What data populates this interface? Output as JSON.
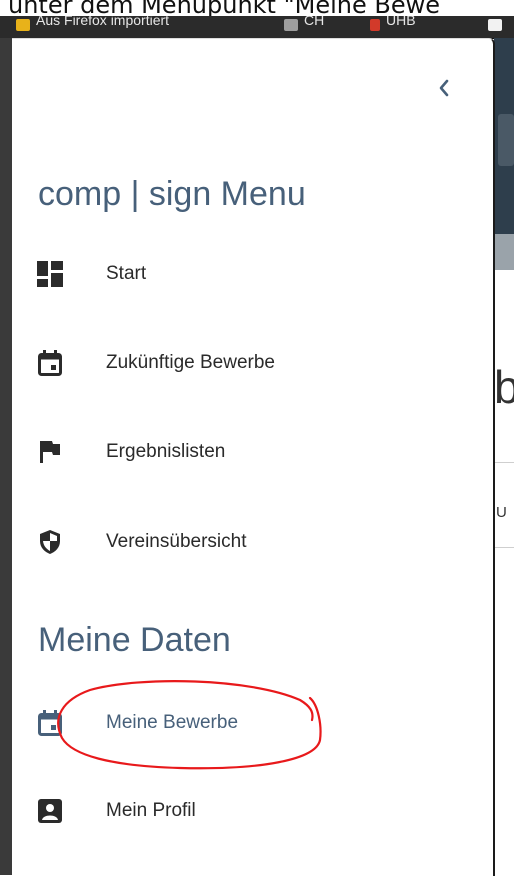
{
  "caption": "unter dem Menupunkt \"Meine Bewe",
  "bookmarks": [
    {
      "label": "Aus Firefox importiert",
      "icon_color": "#e8b21a"
    },
    {
      "label": "CH",
      "icon_color": "#9e9e9e"
    },
    {
      "label": "UHB",
      "icon_color": "#d23a2a"
    }
  ],
  "menu": {
    "collapse_icon": "chevron-left-icon",
    "title": "comp | sign Menu",
    "items": [
      {
        "label": "Start",
        "icon": "dashboard-icon"
      },
      {
        "label": "Zukünftige Bewerbe",
        "icon": "calendar-icon"
      },
      {
        "label": "Ergebnislisten",
        "icon": "flag-icon"
      },
      {
        "label": "Vereinsübersicht",
        "icon": "shield-icon"
      }
    ]
  },
  "my_data": {
    "title": "Meine Daten",
    "items": [
      {
        "label": "Meine Bewerbe",
        "icon": "calendar-icon",
        "active": true
      },
      {
        "label": "Mein Profil",
        "icon": "account-box-icon"
      }
    ]
  },
  "background": {
    "heading_letter": "b",
    "column_letter": "U"
  },
  "colors": {
    "accent": "#47607a",
    "icon": "#2b2b2b",
    "annotation": "#e8191b"
  }
}
